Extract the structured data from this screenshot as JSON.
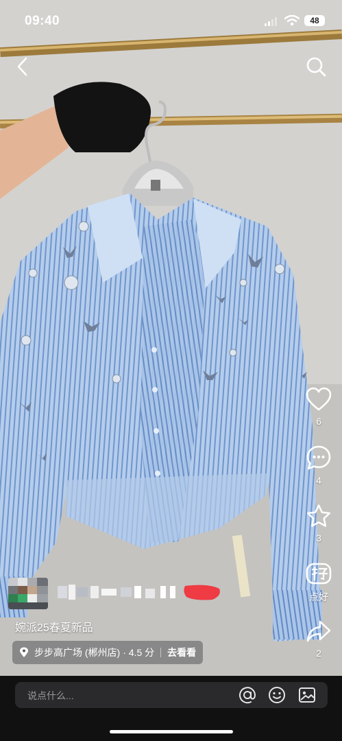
{
  "status_bar": {
    "time": "09:40",
    "battery": "48"
  },
  "actions": {
    "like_count": "6",
    "comment_count": "4",
    "favorite_count": "3",
    "recommend_label": "点好",
    "share_count": "2"
  },
  "post": {
    "caption": "婉派25春夏新品",
    "location": {
      "name": "步步高广场 (郴州店)",
      "rating": "· 4.5 分",
      "action": "去看看"
    }
  },
  "comment_bar": {
    "placeholder": "说点什么..."
  },
  "colors": {
    "background": "#111111",
    "comment_field": "#2a2a2c",
    "shirt": "#a7c3e6"
  },
  "icons": [
    "back-icon",
    "search-icon",
    "heart-icon",
    "comment-icon",
    "star-icon",
    "recommend-icon",
    "share-icon",
    "location-pin-icon",
    "at-icon",
    "emoji-icon",
    "image-icon"
  ]
}
